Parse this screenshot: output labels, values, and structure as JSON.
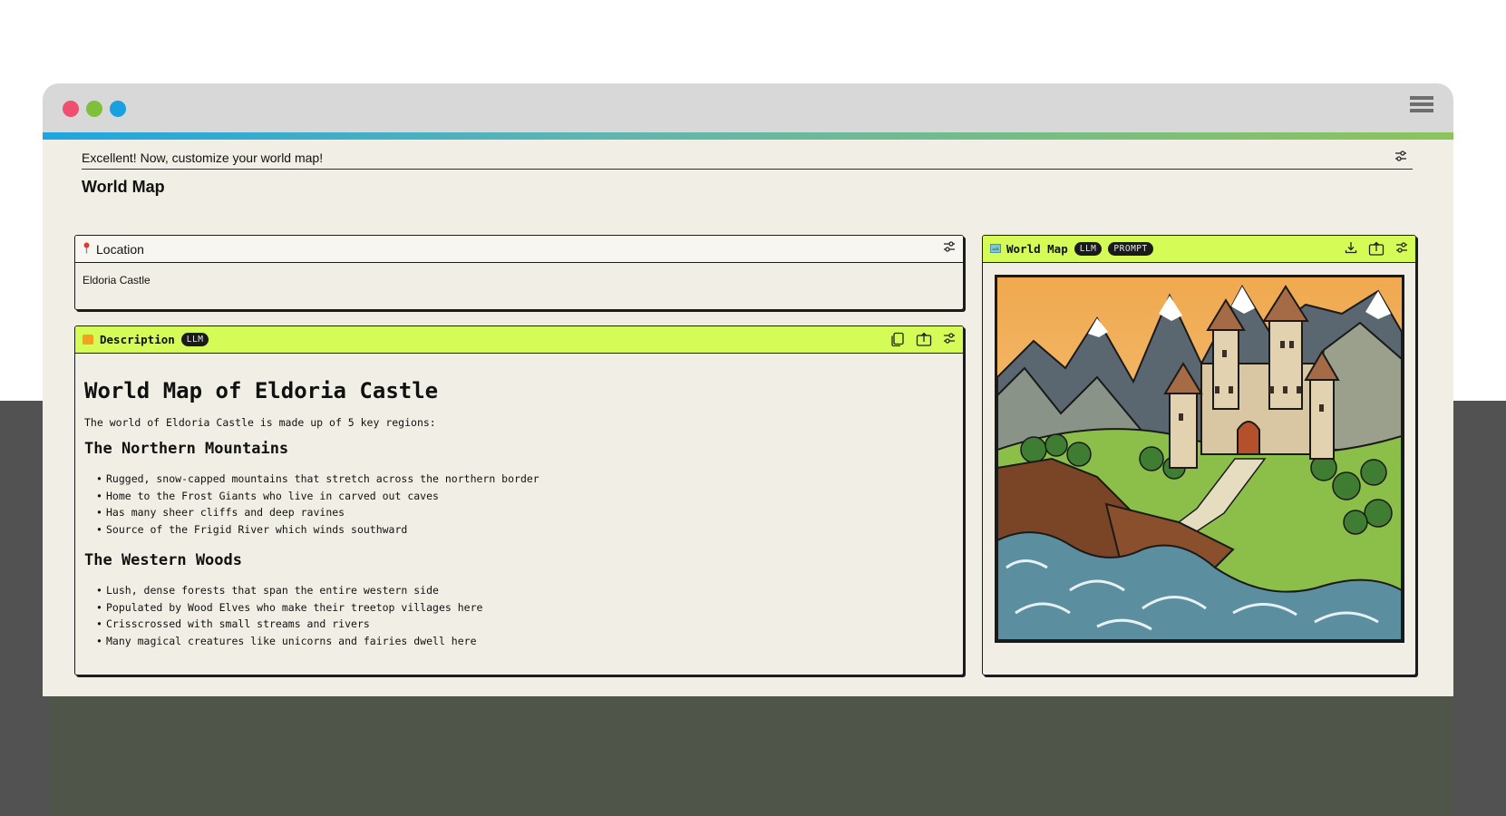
{
  "prompt": {
    "text": "Excellent! Now, customize your world map!"
  },
  "page": {
    "title": "World Map"
  },
  "location": {
    "label": "Location",
    "value": "Eldoria Castle"
  },
  "description": {
    "label": "Description",
    "badge": "LLM",
    "heading": "World Map of Eldoria Castle",
    "intro": "The world of Eldoria Castle is made up of 5 key regions:",
    "sections": [
      {
        "title": "The Northern Mountains",
        "items": [
          "Rugged, snow-capped mountains that stretch across the northern border",
          "Home to the Frost Giants who live in carved out caves",
          "Has many sheer cliffs and deep ravines",
          "Source of the Frigid River which winds southward"
        ]
      },
      {
        "title": "The Western Woods",
        "items": [
          "Lush, dense forests that span the entire western side",
          "Populated by Wood Elves who make their treetop villages here",
          "Crisscrossed with small streams and rivers",
          "Many magical creatures like unicorns and fairies dwell here"
        ]
      }
    ]
  },
  "world_map": {
    "label": "World Map",
    "badges": [
      "LLM",
      "PROMPT"
    ]
  },
  "icons": {
    "location": "pin-icon",
    "description": "note-icon",
    "world_map": "map-icon",
    "settings": "sliders-icon",
    "copy": "copy-icon",
    "share": "share-icon",
    "download": "download-icon",
    "menu": "hamburger-icon"
  },
  "colors": {
    "accent_lime": "#d4fb56",
    "window_bg": "#f1efe5",
    "dot_red": "#f0506e",
    "dot_green": "#7fbf3a",
    "dot_blue": "#1aa0de"
  }
}
